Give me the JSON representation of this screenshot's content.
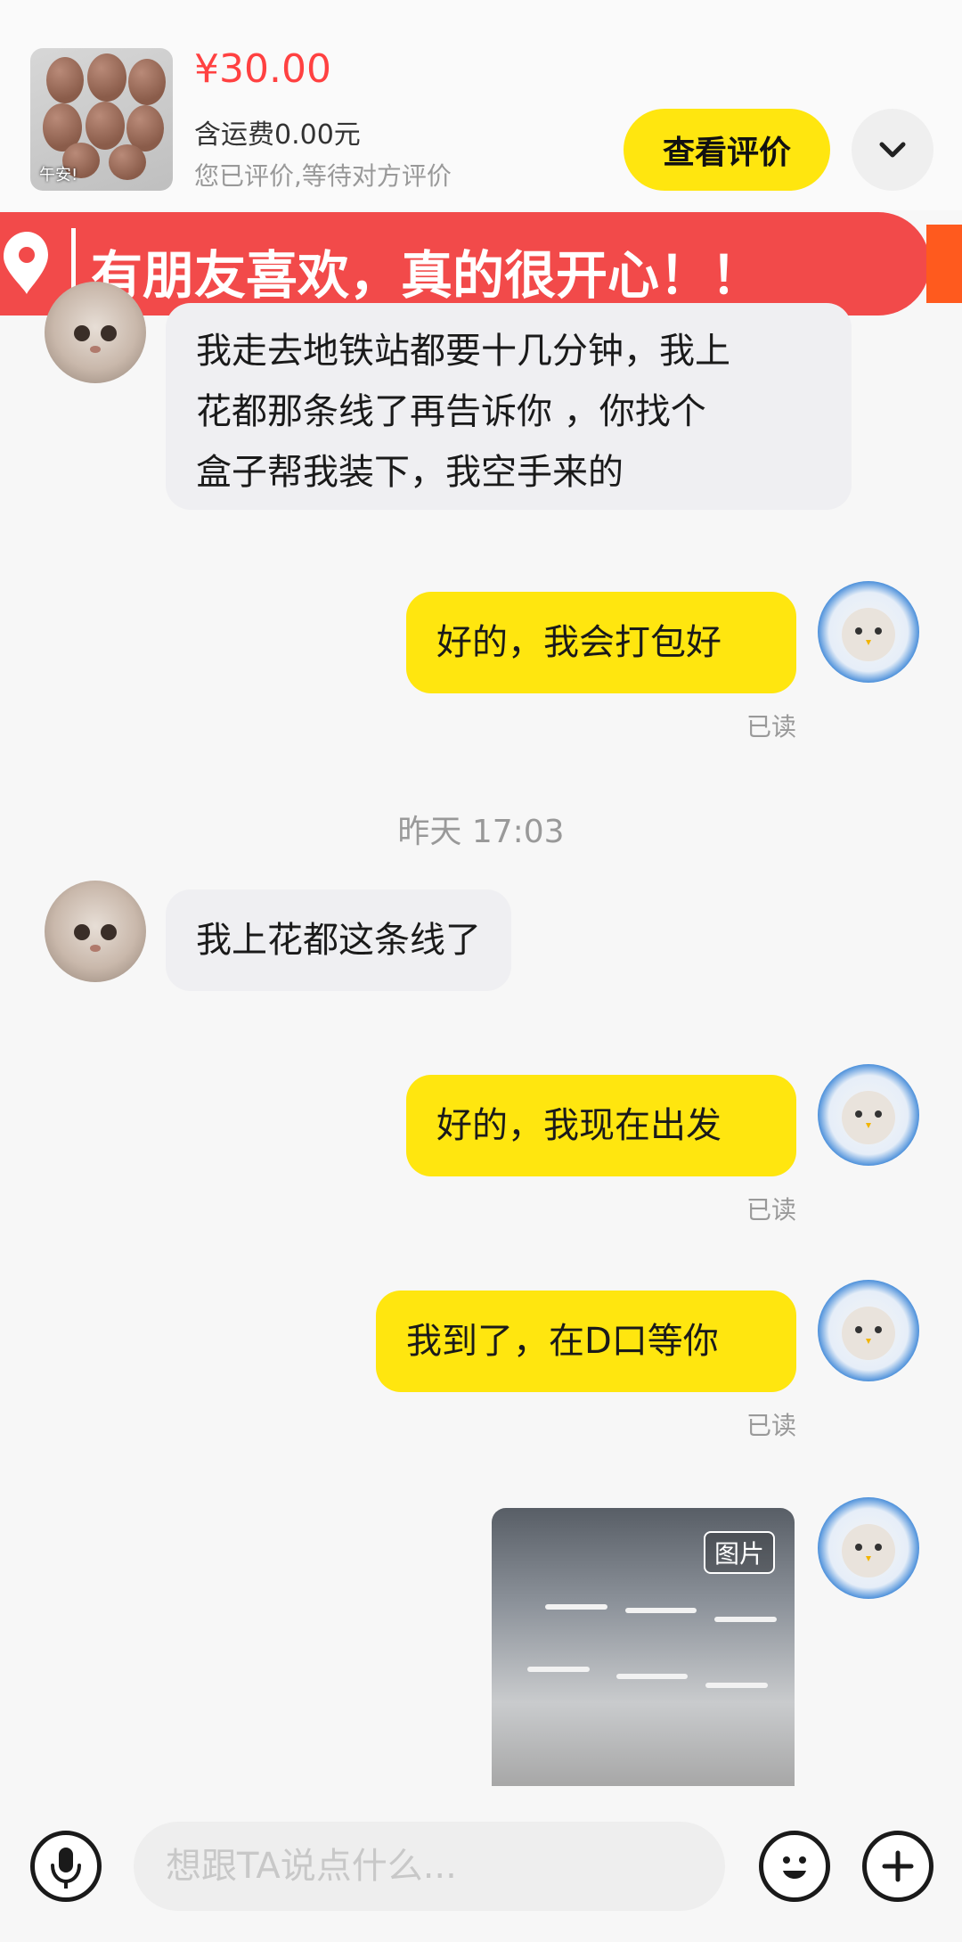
{
  "header": {
    "price": "¥30.00",
    "shipping": "含运费0.00元",
    "review_status": "您已评价,等待对方评价",
    "review_button": "查看评价",
    "thumb_caption": "午安!"
  },
  "banner": {
    "text": "有朋友喜欢，真的很开心！！",
    "color": "#f24a4a"
  },
  "messages": [
    {
      "side": "left",
      "lines": [
        "我走去地铁站都要十几分钟，我上",
        "花都那条线了再告诉你 ，你找个",
        "盒子帮我装下，我空手来的"
      ]
    },
    {
      "side": "right",
      "text": "好的，我会打包好",
      "read": "已读"
    },
    {
      "timestamp": "昨天 17:03"
    },
    {
      "side": "left",
      "text": "我上花都这条线了"
    },
    {
      "side": "right",
      "text": "好的，我现在出发",
      "read": "已读"
    },
    {
      "side": "right",
      "text": "我到了，在D口等你",
      "read": "已读"
    },
    {
      "side": "right",
      "type": "image",
      "tag": "图片"
    }
  ],
  "input": {
    "placeholder": "想跟TA说点什么..."
  },
  "icons": {
    "location": "map-pin-icon",
    "expand": "chevron-down-icon",
    "voice": "microphone-icon",
    "emoji": "smiley-icon",
    "more": "plus-icon"
  },
  "colors": {
    "accent_yellow": "#ffe60f",
    "price_red": "#ff4141"
  }
}
